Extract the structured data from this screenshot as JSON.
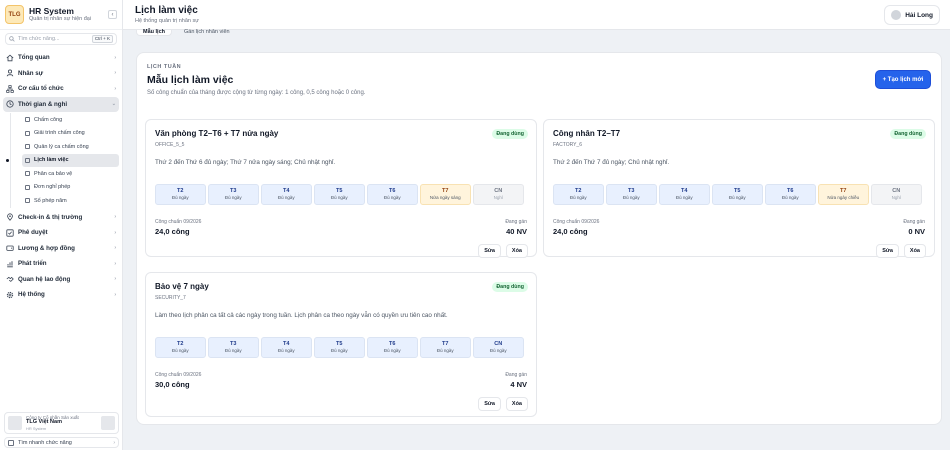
{
  "brand": {
    "logo_text": "TLG",
    "title": "HR System",
    "subtitle": "Quản trị nhân sự hiện đại",
    "collapse_glyph": "‹"
  },
  "search": {
    "placeholder": "Tìm chức năng...",
    "shortcut": "Ctrl + K",
    "icon": "search-icon"
  },
  "nav": [
    {
      "label": "Tổng quan",
      "icon": "home-icon"
    },
    {
      "label": "Nhân sự",
      "icon": "users-icon"
    },
    {
      "label": "Cơ cấu tổ chức",
      "icon": "org-icon"
    },
    {
      "label": "Thời gian & nghỉ",
      "icon": "clock-icon",
      "open": true,
      "children": [
        "Chấm công",
        "Giải trình chấm công",
        "Quản lý ca chấm công",
        "Lịch làm việc",
        "Phân ca bảo vệ",
        "Đơn nghỉ phép",
        "Sổ phép năm"
      ],
      "active_child": "Lịch làm việc"
    },
    {
      "label": "Check-in & thị trường",
      "icon": "location-icon"
    },
    {
      "label": "Phê duyệt",
      "icon": "check-icon"
    },
    {
      "label": "Lương & hợp đồng",
      "icon": "wallet-icon"
    },
    {
      "label": "Phát triển",
      "icon": "chart-icon"
    },
    {
      "label": "Quan hệ lao động",
      "icon": "handshake-icon"
    },
    {
      "label": "Hệ thống",
      "icon": "gear-icon"
    }
  ],
  "company": {
    "line1": "Công ty Cổ phần Sản xuất",
    "name": "TLG Việt Nam",
    "line3": "HR System"
  },
  "quick_search": {
    "label": "Tìm nhanh chức năng"
  },
  "topbar": {
    "title": "Lịch làm việc",
    "subtitle": "Hệ thống quản trị nhân sự",
    "user": "Hải Long"
  },
  "tabs": [
    {
      "label": "Mẫu lịch",
      "active": true
    },
    {
      "label": "Gán lịch nhân viên",
      "active": false
    }
  ],
  "section": {
    "label": "LỊCH TUẦN",
    "title": "Mẫu lịch làm việc",
    "description": "Số công chuẩn của tháng được cộng từ từng ngày: 1 công, 0,5 công hoặc 0 công.",
    "create_label": "+ Tạo lịch mới"
  },
  "day_labels": [
    "T2",
    "T3",
    "T4",
    "T5",
    "T6",
    "T7",
    "CN"
  ],
  "schedules": [
    {
      "name": "Văn phòng T2–T6 + T7 nửa ngày",
      "code": "OFFICE_5_5",
      "status": "Đang dùng",
      "description": "Thứ 2 đến Thứ 6 đủ ngày; Thứ 7 nửa ngày sáng; Chủ nhật nghỉ.",
      "days": [
        {
          "detail": "Đủ ngày",
          "kind": "full"
        },
        {
          "detail": "Đủ ngày",
          "kind": "full"
        },
        {
          "detail": "Đủ ngày",
          "kind": "full"
        },
        {
          "detail": "Đủ ngày",
          "kind": "full"
        },
        {
          "detail": "Đủ ngày",
          "kind": "full"
        },
        {
          "detail": "Nửa ngày sáng",
          "kind": "half"
        },
        {
          "detail": "Nghỉ",
          "kind": "off"
        }
      ],
      "std_label": "Công chuẩn 09/2026",
      "std_value": "24,0 công",
      "assigned_label": "Đang gán",
      "assigned_value": "40 NV",
      "edit_label": "Sửa",
      "delete_label": "Xóa"
    },
    {
      "name": "Công nhân T2–T7",
      "code": "FACTORY_6",
      "status": "Đang dùng",
      "description": "Thứ 2 đến Thứ 7 đủ ngày; Chủ nhật nghỉ.",
      "days": [
        {
          "detail": "Đủ ngày",
          "kind": "full"
        },
        {
          "detail": "Đủ ngày",
          "kind": "full"
        },
        {
          "detail": "Đủ ngày",
          "kind": "full"
        },
        {
          "detail": "Đủ ngày",
          "kind": "full"
        },
        {
          "detail": "Đủ ngày",
          "kind": "full"
        },
        {
          "detail": "Nửa ngày chiều",
          "kind": "half"
        },
        {
          "detail": "Nghỉ",
          "kind": "off"
        }
      ],
      "std_label": "Công chuẩn 09/2026",
      "std_value": "24,0 công",
      "assigned_label": "Đang gán",
      "assigned_value": "0 NV",
      "edit_label": "Sửa",
      "delete_label": "Xóa"
    },
    {
      "name": "Bảo vệ 7 ngày",
      "code": "SECURITY_7",
      "status": "Đang dùng",
      "description": "Làm theo lịch phân ca tất cả các ngày trong tuần. Lịch phân ca theo ngày vẫn có quyền ưu tiên cao nhất.",
      "days": [
        {
          "detail": "Đủ ngày",
          "kind": "full"
        },
        {
          "detail": "Đủ ngày",
          "kind": "full"
        },
        {
          "detail": "Đủ ngày",
          "kind": "full"
        },
        {
          "detail": "Đủ ngày",
          "kind": "full"
        },
        {
          "detail": "Đủ ngày",
          "kind": "full"
        },
        {
          "detail": "Đủ ngày",
          "kind": "full"
        },
        {
          "detail": "Đủ ngày",
          "kind": "full"
        }
      ],
      "std_label": "Công chuẩn 09/2026",
      "std_value": "30,0 công",
      "assigned_label": "Đang gán",
      "assigned_value": "4 NV",
      "edit_label": "Sửa",
      "delete_label": "Xóa"
    }
  ]
}
